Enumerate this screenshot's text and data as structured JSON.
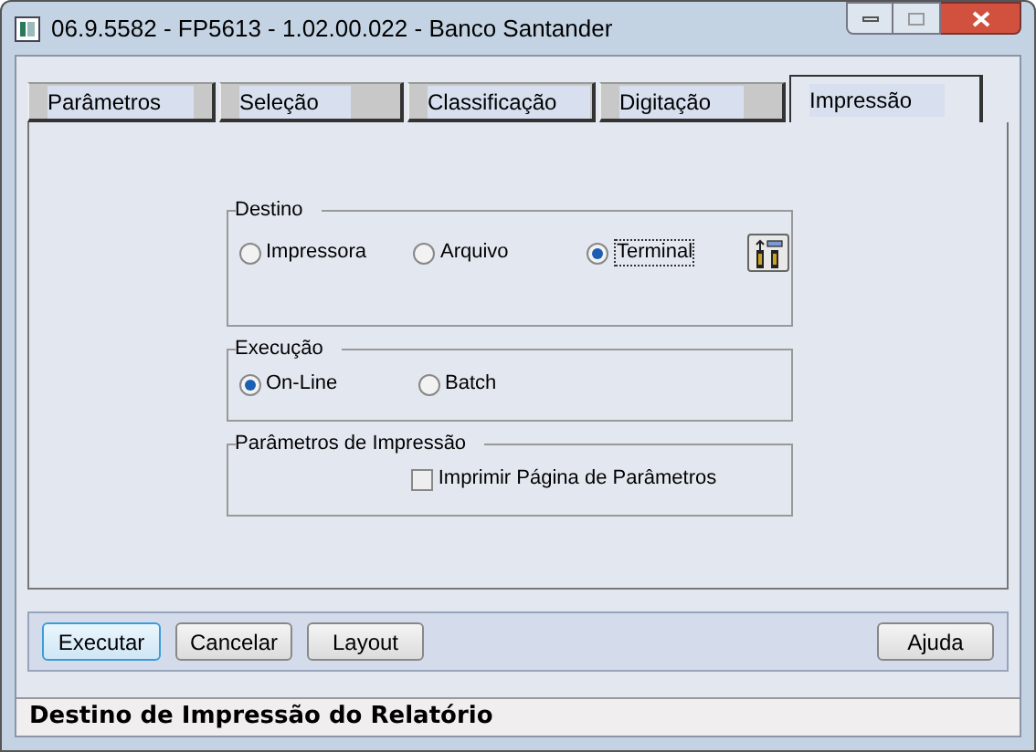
{
  "window": {
    "title": "06.9.5582 - FP5613 - 1.02.00.022 - Banco Santander"
  },
  "tabs": [
    {
      "label": "Parâmetros",
      "selected": false
    },
    {
      "label": "Seleção",
      "selected": false
    },
    {
      "label": "Classificação",
      "selected": false
    },
    {
      "label": "Digitação",
      "selected": false
    },
    {
      "label": "Impressão",
      "selected": true
    }
  ],
  "groups": [
    {
      "title": "Destino",
      "kind": "radio",
      "options": [
        {
          "label": "Impressora",
          "selected": false
        },
        {
          "label": "Arquivo",
          "selected": false
        },
        {
          "label": "Terminal",
          "selected": true
        }
      ]
    },
    {
      "title": "Execução",
      "kind": "radio",
      "options": [
        {
          "label": "On-Line",
          "selected": true
        },
        {
          "label": "Batch",
          "selected": false
        }
      ]
    },
    {
      "title": "Parâmetros de Impressão",
      "kind": "checkbox",
      "options": [
        {
          "label": "Imprimir Página de Parâmetros",
          "checked": false
        }
      ]
    }
  ],
  "buttons": [
    "Executar",
    "Cancelar",
    "Layout"
  ],
  "help_button": "Ajuda",
  "status_bar": "Destino de Impressão do Relatório"
}
